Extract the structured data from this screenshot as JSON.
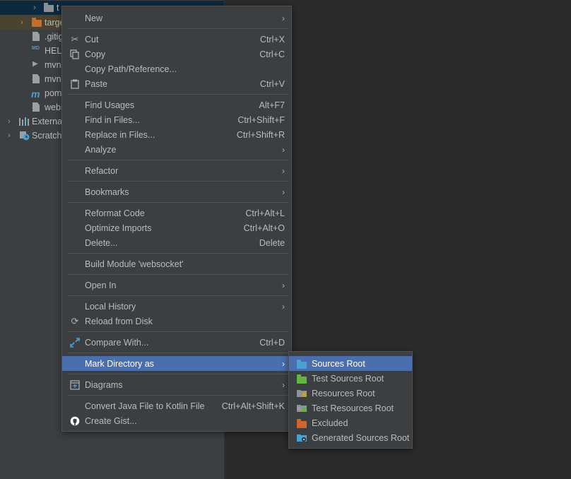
{
  "project_tree": {
    "items": [
      {
        "label": "t",
        "icon": "folder-icon",
        "color": "#8a8f94",
        "arrow": "›",
        "selected": true
      },
      {
        "label": "targe",
        "icon": "folder-icon",
        "color": "#c76c2e",
        "arrow": "›",
        "highlight": true
      },
      {
        "label": ".gitig",
        "icon": "file-icon"
      },
      {
        "label": "HELI",
        "icon": "markdown-file-icon"
      },
      {
        "label": "mvn",
        "icon": "terminal-file-icon"
      },
      {
        "label": "mvn",
        "icon": "file-icon"
      },
      {
        "label": "pom",
        "icon": "maven-icon"
      },
      {
        "label": "webs",
        "icon": "file-icon"
      },
      {
        "label": "External",
        "icon": "library-icon",
        "arrow": "›"
      },
      {
        "label": "Scratche",
        "icon": "scratches-icon",
        "arrow": "›"
      }
    ]
  },
  "context_menu": {
    "new": {
      "label": "New"
    },
    "cut": {
      "label": "Cut",
      "shortcut": "Ctrl+X"
    },
    "copy": {
      "label": "Copy",
      "shortcut": "Ctrl+C"
    },
    "copy_path": {
      "label": "Copy Path/Reference..."
    },
    "paste": {
      "label": "Paste",
      "shortcut": "Ctrl+V"
    },
    "find_usages": {
      "label": "Find Usages",
      "shortcut": "Alt+F7"
    },
    "find_in_files": {
      "label": "Find in Files...",
      "shortcut": "Ctrl+Shift+F"
    },
    "replace_in_files": {
      "label": "Replace in Files...",
      "shortcut": "Ctrl+Shift+R"
    },
    "analyze": {
      "label": "Analyze"
    },
    "refactor": {
      "label": "Refactor"
    },
    "bookmarks": {
      "label": "Bookmarks"
    },
    "reformat_code": {
      "label": "Reformat Code",
      "shortcut": "Ctrl+Alt+L"
    },
    "optimize_imports": {
      "label": "Optimize Imports",
      "shortcut": "Ctrl+Alt+O"
    },
    "delete": {
      "label": "Delete...",
      "shortcut": "Delete"
    },
    "build_module": {
      "label": "Build Module 'websocket'"
    },
    "open_in": {
      "label": "Open In"
    },
    "local_history": {
      "label": "Local History"
    },
    "reload_from_disk": {
      "label": "Reload from Disk"
    },
    "compare_with": {
      "label": "Compare With...",
      "shortcut": "Ctrl+D"
    },
    "mark_directory_as": {
      "label": "Mark Directory as"
    },
    "diagrams": {
      "label": "Diagrams"
    },
    "convert_java": {
      "label": "Convert Java File to Kotlin File",
      "shortcut": "Ctrl+Alt+Shift+K"
    },
    "create_gist": {
      "label": "Create Gist..."
    }
  },
  "submenu": {
    "items": [
      {
        "label": "Sources Root",
        "icon": "sources-root-folder-icon",
        "color": "#4a9fd4"
      },
      {
        "label": "Test Sources Root",
        "icon": "test-sources-folder-icon",
        "color": "#62b543"
      },
      {
        "label": "Resources Root",
        "icon": "resources-folder-icon",
        "color": "#8f9396"
      },
      {
        "label": "Test Resources Root",
        "icon": "test-resources-folder-icon",
        "color": "#8f9396"
      },
      {
        "label": "Excluded",
        "icon": "excluded-folder-icon",
        "color": "#d0642d"
      },
      {
        "label": "Generated Sources Root",
        "icon": "generated-sources-folder-icon",
        "color": "#4a9fd4"
      }
    ]
  },
  "colors": {
    "menu_bg": "#3c3f41",
    "selection": "#4b6eaf",
    "separator": "#515151",
    "text": "#bbbbbb"
  }
}
